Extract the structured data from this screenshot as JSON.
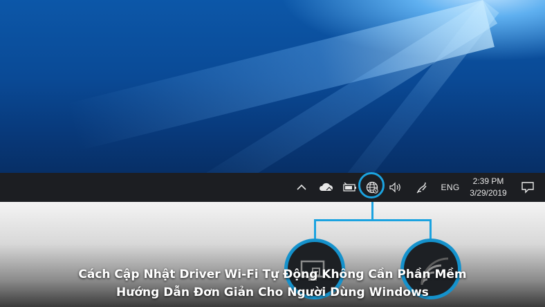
{
  "taskbar": {
    "tray_icons": [
      "chevron-up-icon",
      "onedrive-cloud-icon",
      "battery-icon",
      "network-globe-icon",
      "volume-icon",
      "pen-icon"
    ],
    "language": "ENG",
    "clock": {
      "time": "2:39 PM",
      "date": "3/29/2019"
    },
    "notification_icon": "action-center-icon"
  },
  "zoom_callouts": [
    "ethernet-disconnected-icon",
    "wifi-icon"
  ],
  "caption": {
    "line1": "Cách Cập Nhật Driver Wi-Fi Tự Động Không Cần Phần Mềm",
    "line2": "Hướng Dẫn Đơn Giản Cho Người Dùng Windows"
  },
  "colors": {
    "highlight": "#1ba3e0",
    "taskbar": "#1c1e22",
    "desktop": "#0a4a96"
  }
}
